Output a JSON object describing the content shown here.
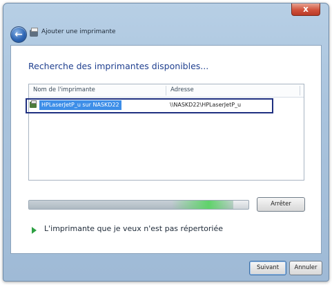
{
  "window": {
    "close_label": "x",
    "title": "Ajouter une imprimante"
  },
  "nav": {
    "back_label": "←"
  },
  "main": {
    "heading": "Recherche des imprimantes disponibles...",
    "list": {
      "columns": [
        "Nom de l'imprimante",
        "Adresse"
      ],
      "rows": [
        {
          "name": "HPLaserJetP_u sur NASKD22",
          "address": "\\\\NASKD22\\HPLaserJetP_u"
        }
      ]
    },
    "progress": {
      "fraction": 0.93
    },
    "stop_label": "Arrêter",
    "not_listed_link": "L'imprimante que je veux n'est pas répertoriée"
  },
  "footer": {
    "next_label": "Suivant",
    "cancel_label": "Annuler"
  },
  "colors": {
    "accent": "#3d8ee8",
    "selection_border": "#1e2f80",
    "heading": "#1f3f8f",
    "progress_glow": "#5fd36a"
  }
}
